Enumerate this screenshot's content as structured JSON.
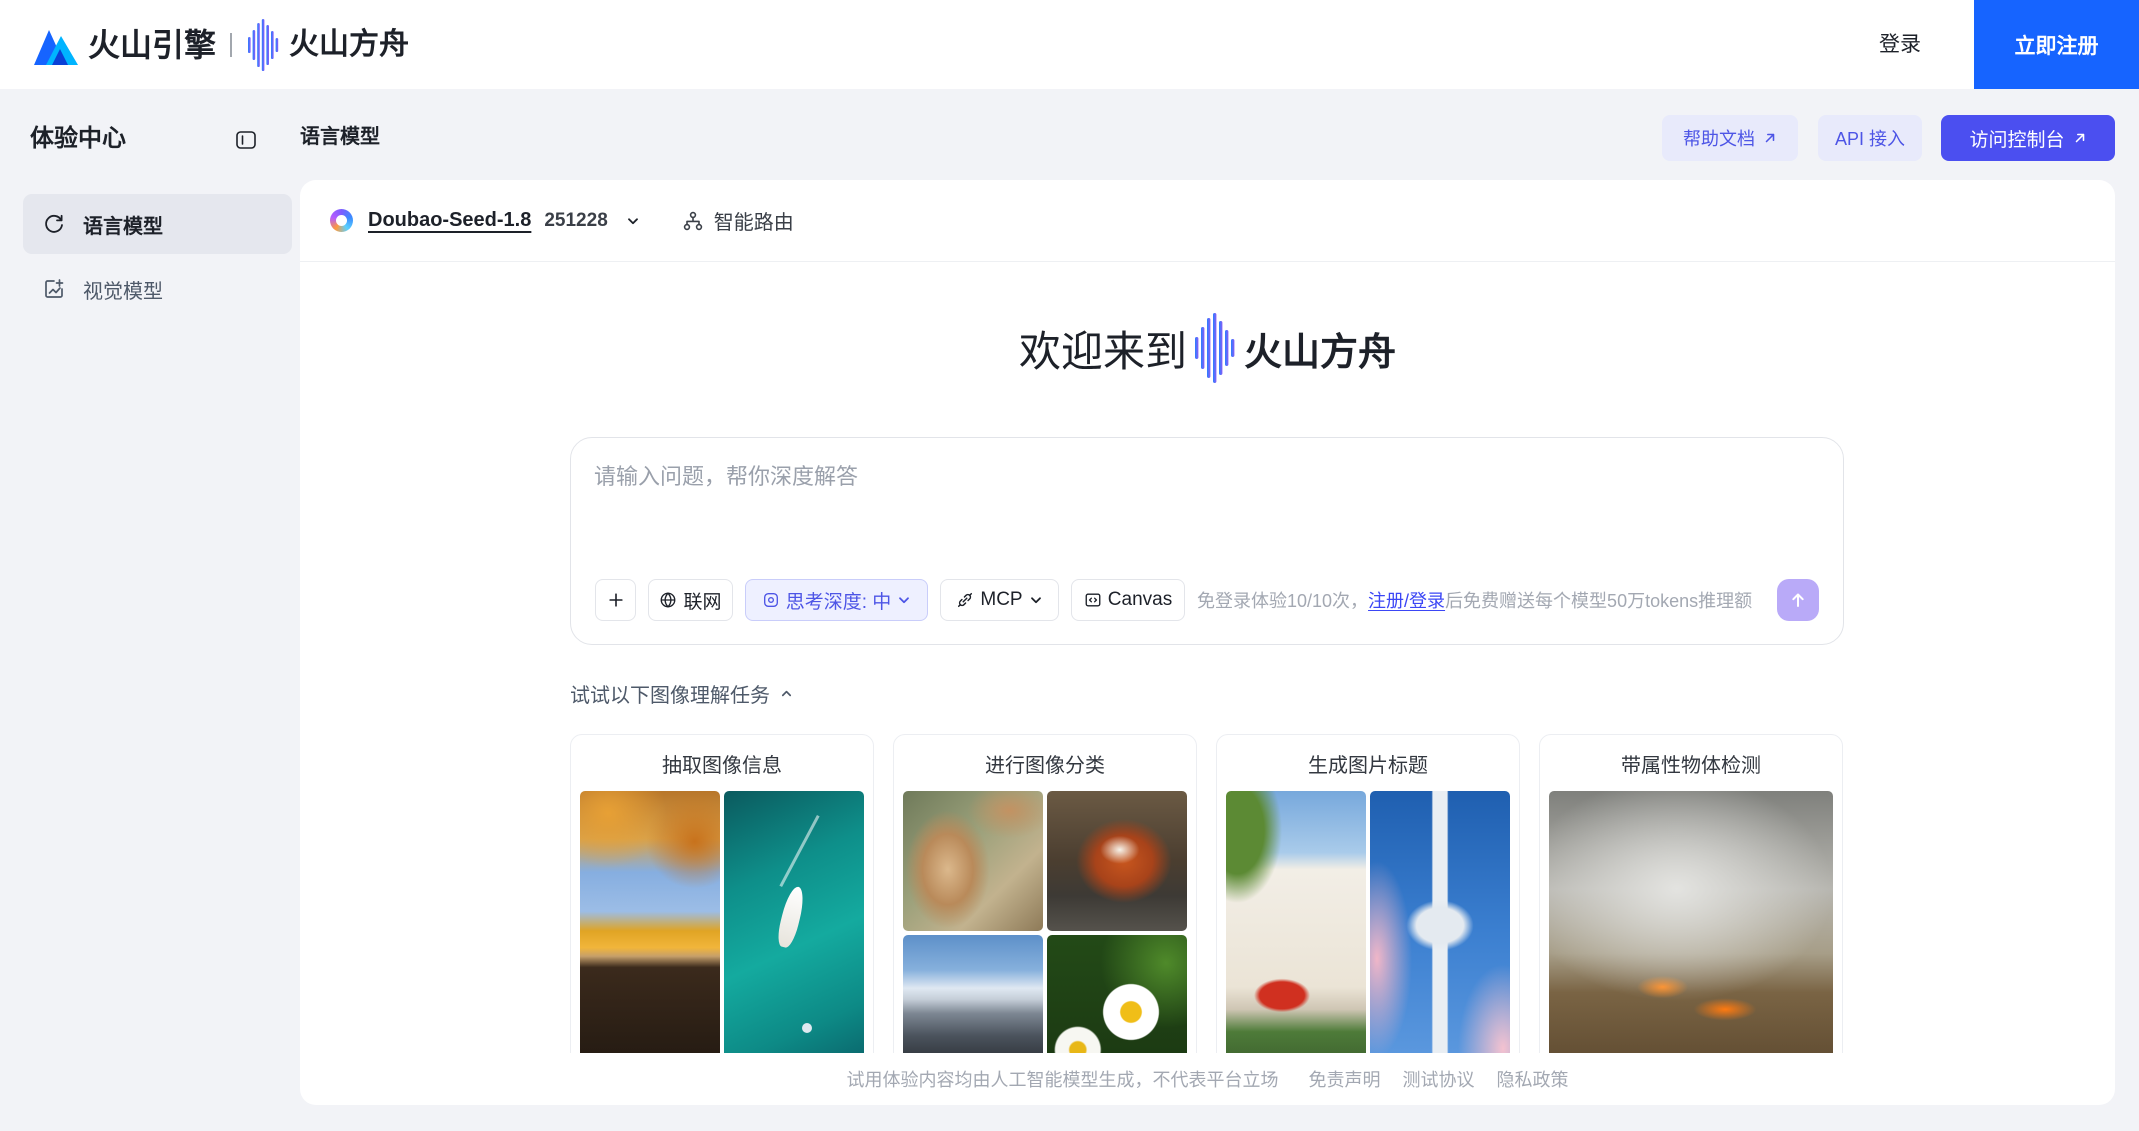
{
  "theme": {
    "brand": "#1664ff",
    "accent": "#4b4ff0",
    "accent_soft": "#e8eafb",
    "accent_text": "#4d55e6",
    "send": "#b9aaf8",
    "page_bg": "#f2f3f7",
    "link": "#3b46f5"
  },
  "header": {
    "brand_primary": "火山引擎",
    "brand_secondary": "火山方舟",
    "login_label": "登录",
    "signup_label": "立即注册",
    "icons": {
      "brand_primary": "volcano-engine-logo-icon",
      "brand_secondary": "ark-logo-icon"
    }
  },
  "sidebar": {
    "title": "体验中心",
    "collapse_icon": "sidebar-collapse-icon",
    "items": [
      {
        "label": "语言模型",
        "icon": "chat-refresh-icon",
        "active": true
      },
      {
        "label": "视觉模型",
        "icon": "image-edit-icon",
        "active": false
      }
    ]
  },
  "main": {
    "title": "语言模型",
    "actions": {
      "help_docs": "帮助文档",
      "api_access": "API 接入",
      "console": "访问控制台"
    }
  },
  "model_bar": {
    "model_name": "Doubao-Seed-1.8",
    "model_version": "251228",
    "routing_label": "智能路由"
  },
  "welcome": {
    "prefix": "欢迎来到",
    "brand": "火山方舟"
  },
  "composer": {
    "placeholder": "请输入问题，帮你深度解答",
    "tools": {
      "web": "联网",
      "thinking_depth": "思考深度: 中",
      "mcp": "MCP",
      "canvas": "Canvas"
    },
    "notice": {
      "prefix": "免登录体验10/10次，",
      "link": "注册/登录",
      "suffix": "后免费赠送每个模型50万tokens推理额"
    }
  },
  "tasks": {
    "title": "试试以下图像理解任务",
    "cards": [
      {
        "title": "抽取图像信息"
      },
      {
        "title": "进行图像分类"
      },
      {
        "title": "生成图片标题"
      },
      {
        "title": "带属性物体检测"
      }
    ]
  },
  "footer": {
    "disclaimer": "试用体验内容均由人工智能模型生成，不代表平台立场",
    "links": [
      "免责声明",
      "测试协议",
      "隐私政策"
    ]
  }
}
